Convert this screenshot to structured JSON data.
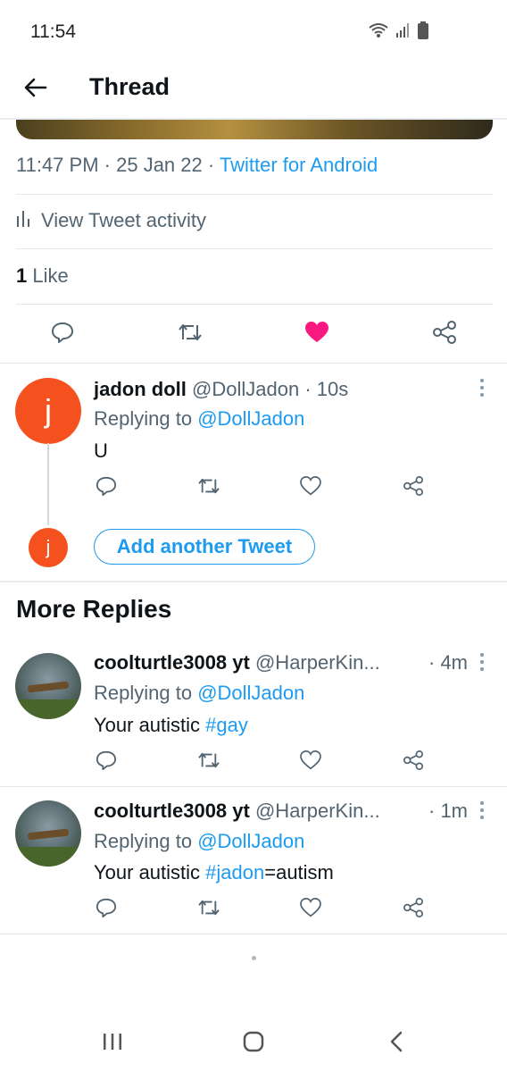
{
  "status_bar": {
    "time": "11:54"
  },
  "app_bar": {
    "title": "Thread"
  },
  "tweet": {
    "time": "11:47 PM",
    "date": "25 Jan 22",
    "source": "Twitter for Android",
    "activity_label": "View Tweet activity",
    "like_count": "1",
    "like_label": " Like",
    "liked_color": "#f91880"
  },
  "my_reply": {
    "avatar_letter": "j",
    "name": "jadon doll",
    "handle": "@DollJadon",
    "time": "10s",
    "replying_prefix": "Replying to ",
    "replying_to": "@DollJadon",
    "text": "U",
    "composer_avatar_letter": "j",
    "add_button": "Add another Tweet"
  },
  "more_replies": {
    "title": "More Replies",
    "items": [
      {
        "name": "coolturtle3008 yt",
        "handle": "@HarperKin...",
        "time": "4m",
        "replying_prefix": "Replying to ",
        "replying_to": "@DollJadon",
        "text_plain": "Your autistic ",
        "hashtag": "#gay",
        "text_after": ""
      },
      {
        "name": "coolturtle3008 yt",
        "handle": "@HarperKin...",
        "time": "1m",
        "replying_prefix": "Replying to ",
        "replying_to": "@DollJadon",
        "text_plain": "Your autistic ",
        "hashtag": "#jadon",
        "text_after": "=autism"
      }
    ]
  },
  "colors": {
    "accent": "#1d9bf0",
    "avatar_orange": "#f4511e",
    "like_pink": "#f91880"
  }
}
